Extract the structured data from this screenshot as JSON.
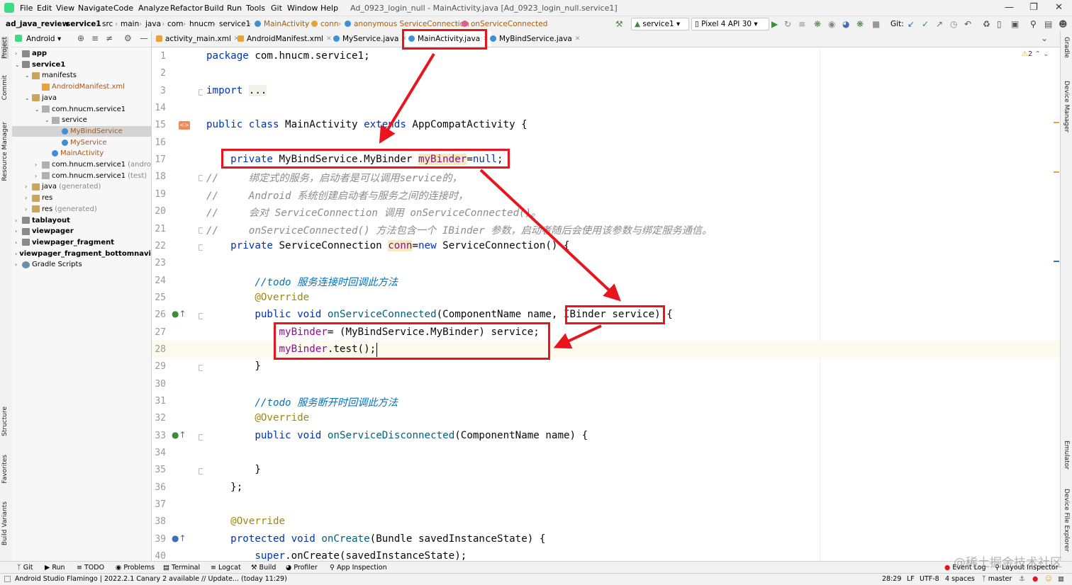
{
  "menubar": {
    "items": [
      "File",
      "Edit",
      "View",
      "Navigate",
      "Code",
      "Analyze",
      "Refactor",
      "Build",
      "Run",
      "Tools",
      "Git",
      "Window",
      "Help"
    ],
    "window_title": "Ad_0923_login_null - MainActivity.java [Ad_0923_login_null.service1]"
  },
  "navbar": {
    "crumbs": [
      "ad_java_review",
      "service1",
      "src",
      "main",
      "java",
      "com",
      "hnucm",
      "service1",
      "MainActivity",
      "conn",
      "anonymous ServiceConnection",
      "onServiceConnected"
    ],
    "run_config": "service1",
    "device": "Pixel 4 API 30",
    "git_label": "Git:"
  },
  "left_strip": [
    "Project",
    "Commit",
    "Resource Manager",
    "Structure",
    "Favorites",
    "Build Variants"
  ],
  "right_strip": [
    "Gradle",
    "Device Manager",
    "Emulator",
    "Device File Explorer"
  ],
  "project_panel": {
    "view_mode": "Android",
    "tree": [
      {
        "label": "app",
        "kind": "module",
        "depth": 0,
        "bold": true,
        "arrow": "›"
      },
      {
        "label": "service1",
        "kind": "module",
        "depth": 0,
        "bold": true,
        "arrow": "⌄"
      },
      {
        "label": "manifests",
        "kind": "folder",
        "depth": 1,
        "arrow": "⌄"
      },
      {
        "label": "AndroidManifest.xml",
        "kind": "xml",
        "depth": 2,
        "color": "orange"
      },
      {
        "label": "java",
        "kind": "folder",
        "depth": 1,
        "arrow": "⌄"
      },
      {
        "label": "com.hnucm.service1",
        "kind": "pkg",
        "depth": 2,
        "arrow": "⌄"
      },
      {
        "label": "service",
        "kind": "pkg",
        "depth": 3,
        "arrow": "⌄"
      },
      {
        "label": "MyBindService",
        "kind": "cls",
        "depth": 4,
        "color": "orange",
        "selected": true
      },
      {
        "label": "MyService",
        "kind": "cls",
        "depth": 4,
        "color": "orange"
      },
      {
        "label": "MainActivity",
        "kind": "cls",
        "depth": 3,
        "color": "orange"
      },
      {
        "label": "com.hnucm.service1",
        "suffix": "(android",
        "kind": "pkg",
        "depth": 2,
        "arrow": "›"
      },
      {
        "label": "com.hnucm.service1",
        "suffix": "(test)",
        "kind": "pkg",
        "depth": 2,
        "arrow": "›"
      },
      {
        "label": "java",
        "suffix": "(generated)",
        "kind": "folder",
        "depth": 1,
        "arrow": "›"
      },
      {
        "label": "res",
        "kind": "folder",
        "depth": 1,
        "arrow": "›"
      },
      {
        "label": "res",
        "suffix": "(generated)",
        "kind": "folder",
        "depth": 1,
        "arrow": "›"
      },
      {
        "label": "tablayout",
        "kind": "module",
        "depth": 0,
        "bold": true,
        "arrow": "›"
      },
      {
        "label": "viewpager",
        "kind": "module",
        "depth": 0,
        "bold": true,
        "arrow": "›"
      },
      {
        "label": "viewpager_fragment",
        "kind": "module",
        "depth": 0,
        "bold": true,
        "arrow": "›"
      },
      {
        "label": "viewpager_fragment_bottomnavig",
        "kind": "module",
        "depth": 0,
        "bold": true,
        "arrow": "›"
      },
      {
        "label": "Gradle Scripts",
        "kind": "gradle",
        "depth": 0,
        "arrow": "›"
      }
    ]
  },
  "editor_tabs": [
    {
      "label": "activity_main.xml",
      "icon": "#e8a23a"
    },
    {
      "label": "AndroidManifest.xml",
      "icon": "#e8a23a"
    },
    {
      "label": "MyService.java",
      "icon": "#3d8fd6"
    },
    {
      "label": "MainActivity.java",
      "icon": "#3d8fd6",
      "active": true
    },
    {
      "label": "MyBindService.java",
      "icon": "#3d8fd6"
    }
  ],
  "editor": {
    "warning_count": "2",
    "lines": [
      {
        "n": "1",
        "html": "<span class=\"kw\">package</span> com.hnucm.service1;"
      },
      {
        "n": "2",
        "html": ""
      },
      {
        "n": "3",
        "html": "<span class=\"kw\">import</span> <span style=\"background:#edf4e6\">...</span>"
      },
      {
        "n": "14",
        "html": ""
      },
      {
        "n": "15",
        "html": "<span class=\"kw\">public class</span> MainActivity <span class=\"kw\">extends</span> AppCompatActivity {"
      },
      {
        "n": "16",
        "html": ""
      },
      {
        "n": "17",
        "html": "    <span class=\"kw\">private</span> MyBindService.MyBinder <span class=\"fld\" style=\"background:#f6ebbc\">myBinder</span>=<span class=\"kw\">null</span>;"
      },
      {
        "n": "18",
        "html": "<span class=\"cmt\">//     绑定式的服务，启动者是可以调用service的，</span>"
      },
      {
        "n": "19",
        "html": "<span class=\"cmt\">//     Android 系统创建启动者与服务之间的连接时，</span>"
      },
      {
        "n": "20",
        "html": "<span class=\"cmt\">//     会对 ServiceConnection 调用 onServiceConnected()。</span>"
      },
      {
        "n": "21",
        "html": "<span class=\"cmt\">//     onServiceConnected() 方法包含一个 IBinder 参数，启动者随后会使用该参数与绑定服务通信。</span>"
      },
      {
        "n": "22",
        "html": "    <span class=\"kw\">private</span> ServiceConnection <span class=\"fld\" style=\"background:#f6ebbc\">conn</span>=<span class=\"kw\">new</span> ServiceConnection() {"
      },
      {
        "n": "23",
        "html": ""
      },
      {
        "n": "24",
        "html": "        <span class=\"todo\">//todo 服务连接时回调此方法</span>"
      },
      {
        "n": "25",
        "html": "        <span class=\"ann\">@Override</span>"
      },
      {
        "n": "26",
        "html": "        <span class=\"kw\">public void</span> <span class=\"mth\">onServiceConnected</span>(ComponentName name, IBinder service) {"
      },
      {
        "n": "27",
        "html": "            <span class=\"fld\">myBinder</span>= (MyBindService.MyBinder) service;"
      },
      {
        "n": "28",
        "html": "            <span class=\"fld\">myBinder</span>.test();"
      },
      {
        "n": "29",
        "html": "        }"
      },
      {
        "n": "30",
        "html": ""
      },
      {
        "n": "31",
        "html": "        <span class=\"todo\">//todo 服务断开时回调此方法</span>"
      },
      {
        "n": "32",
        "html": "        <span class=\"ann\">@Override</span>"
      },
      {
        "n": "33",
        "html": "        <span class=\"kw\">public void</span> <span class=\"mth\">onServiceDisconnected</span>(ComponentName name) {"
      },
      {
        "n": "34",
        "html": ""
      },
      {
        "n": "35",
        "html": "        }"
      },
      {
        "n": "36",
        "html": "    };"
      },
      {
        "n": "37",
        "html": ""
      },
      {
        "n": "38",
        "html": "    <span class=\"ann\">@Override</span>"
      },
      {
        "n": "39",
        "html": "    <span class=\"kw\">protected void</span> <span class=\"mth\">onCreate</span>(Bundle savedInstanceState) {"
      },
      {
        "n": "40",
        "html": "        <span class=\"kw\">super</span>.onCreate(savedInstanceState);"
      }
    ]
  },
  "toolwindows": [
    "Git",
    "Run",
    "TODO",
    "Problems",
    "Terminal",
    "Logcat",
    "Build",
    "Profiler",
    "App Inspection"
  ],
  "toolwindows_right": [
    "Event Log",
    "Layout Inspector"
  ],
  "statusbar": {
    "message": "Android Studio Flamingo | 2022.2.1 Canary 2 available // Update... (today 11:29)",
    "position": "28:29",
    "line_sep": "LF",
    "encoding": "UTF-8",
    "indent": "4 spaces",
    "branch": "master"
  },
  "watermark": "@稀土掘金技术社区",
  "colors": {
    "highlight": "#e8141e",
    "accent": "#3d8fd6"
  }
}
